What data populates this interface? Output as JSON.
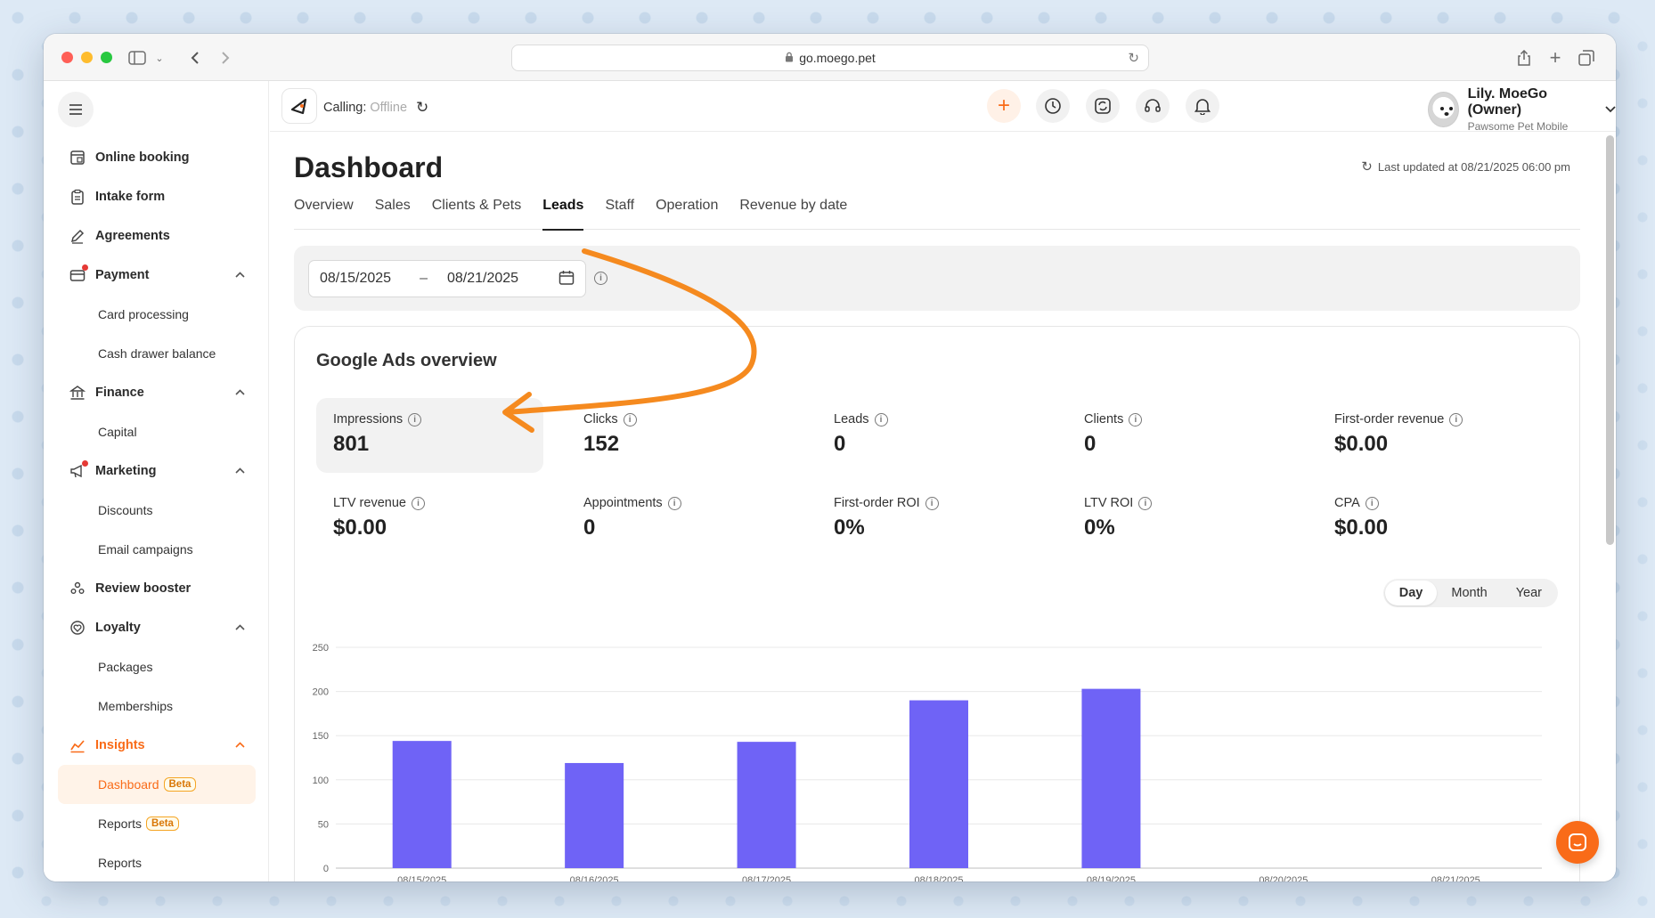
{
  "browser": {
    "url": "go.moego.pet"
  },
  "sidebar": {
    "items": [
      {
        "type": "item",
        "label": "Online booking",
        "icon": "calendar-icon"
      },
      {
        "type": "item",
        "label": "Intake form",
        "icon": "clipboard-icon"
      },
      {
        "type": "item",
        "label": "Agreements",
        "icon": "pen-icon"
      },
      {
        "type": "item",
        "label": "Payment",
        "icon": "payment-icon",
        "dot": true,
        "expanded": true
      },
      {
        "type": "sub",
        "label": "Card processing"
      },
      {
        "type": "sub",
        "label": "Cash drawer balance"
      },
      {
        "type": "item",
        "label": "Finance",
        "icon": "bank-icon",
        "expanded": true
      },
      {
        "type": "sub",
        "label": "Capital"
      },
      {
        "type": "item",
        "label": "Marketing",
        "icon": "megaphone-icon",
        "dot": true,
        "expanded": true
      },
      {
        "type": "sub",
        "label": "Discounts"
      },
      {
        "type": "sub",
        "label": "Email campaigns"
      },
      {
        "type": "item",
        "label": "Review booster",
        "icon": "people-icon"
      },
      {
        "type": "item",
        "label": "Loyalty",
        "icon": "loyalty-icon",
        "expanded": true
      },
      {
        "type": "sub",
        "label": "Packages"
      },
      {
        "type": "sub",
        "label": "Memberships"
      },
      {
        "type": "item",
        "label": "Insights",
        "icon": "chart-line-icon",
        "expanded": true,
        "active": true
      },
      {
        "type": "sub",
        "label": "Dashboard",
        "badge": "Beta",
        "active": true
      },
      {
        "type": "sub",
        "label": "Reports",
        "badge": "Beta"
      },
      {
        "type": "sub",
        "label": "Reports"
      }
    ]
  },
  "topbar": {
    "calling_label": "Calling:",
    "calling_status": "Offline",
    "user_name": "Lily. MoeGo (Owner)",
    "business": "Pawsome Pet Mobile"
  },
  "page": {
    "title": "Dashboard",
    "last_updated": "Last updated at 08/21/2025 06:00 pm",
    "tabs": [
      "Overview",
      "Sales",
      "Clients & Pets",
      "Leads",
      "Staff",
      "Operation",
      "Revenue by date"
    ],
    "active_tab": "Leads",
    "date_start": "08/15/2025",
    "date_sep": "–",
    "date_end": "08/21/2025"
  },
  "card": {
    "title": "Google Ads overview",
    "metrics": [
      {
        "label": "Impressions",
        "value": "801",
        "selected": true
      },
      {
        "label": "Clicks",
        "value": "152"
      },
      {
        "label": "Leads",
        "value": "0"
      },
      {
        "label": "Clients",
        "value": "0"
      },
      {
        "label": "First-order revenue",
        "value": "$0.00"
      },
      {
        "label": "LTV revenue",
        "value": "$0.00"
      },
      {
        "label": "Appointments",
        "value": "0"
      },
      {
        "label": "First-order ROI",
        "value": "0%"
      },
      {
        "label": "LTV ROI",
        "value": "0%"
      },
      {
        "label": "CPA",
        "value": "$0.00"
      }
    ],
    "granularity": [
      "Day",
      "Month",
      "Year"
    ],
    "active_granularity": "Day"
  },
  "colors": {
    "accent": "#f96b18",
    "bar": "#6f63f6",
    "arrow": "#f58a1f"
  },
  "chart_data": {
    "type": "bar",
    "categories": [
      "08/15/2025",
      "08/16/2025",
      "08/17/2025",
      "08/18/2025",
      "08/19/2025",
      "08/20/2025",
      "08/21/2025"
    ],
    "values": [
      144,
      119,
      143,
      190,
      203,
      0,
      0
    ],
    "ylim": [
      0,
      250
    ],
    "yticks": [
      0,
      50,
      100,
      150,
      200,
      250
    ],
    "grid": true
  }
}
